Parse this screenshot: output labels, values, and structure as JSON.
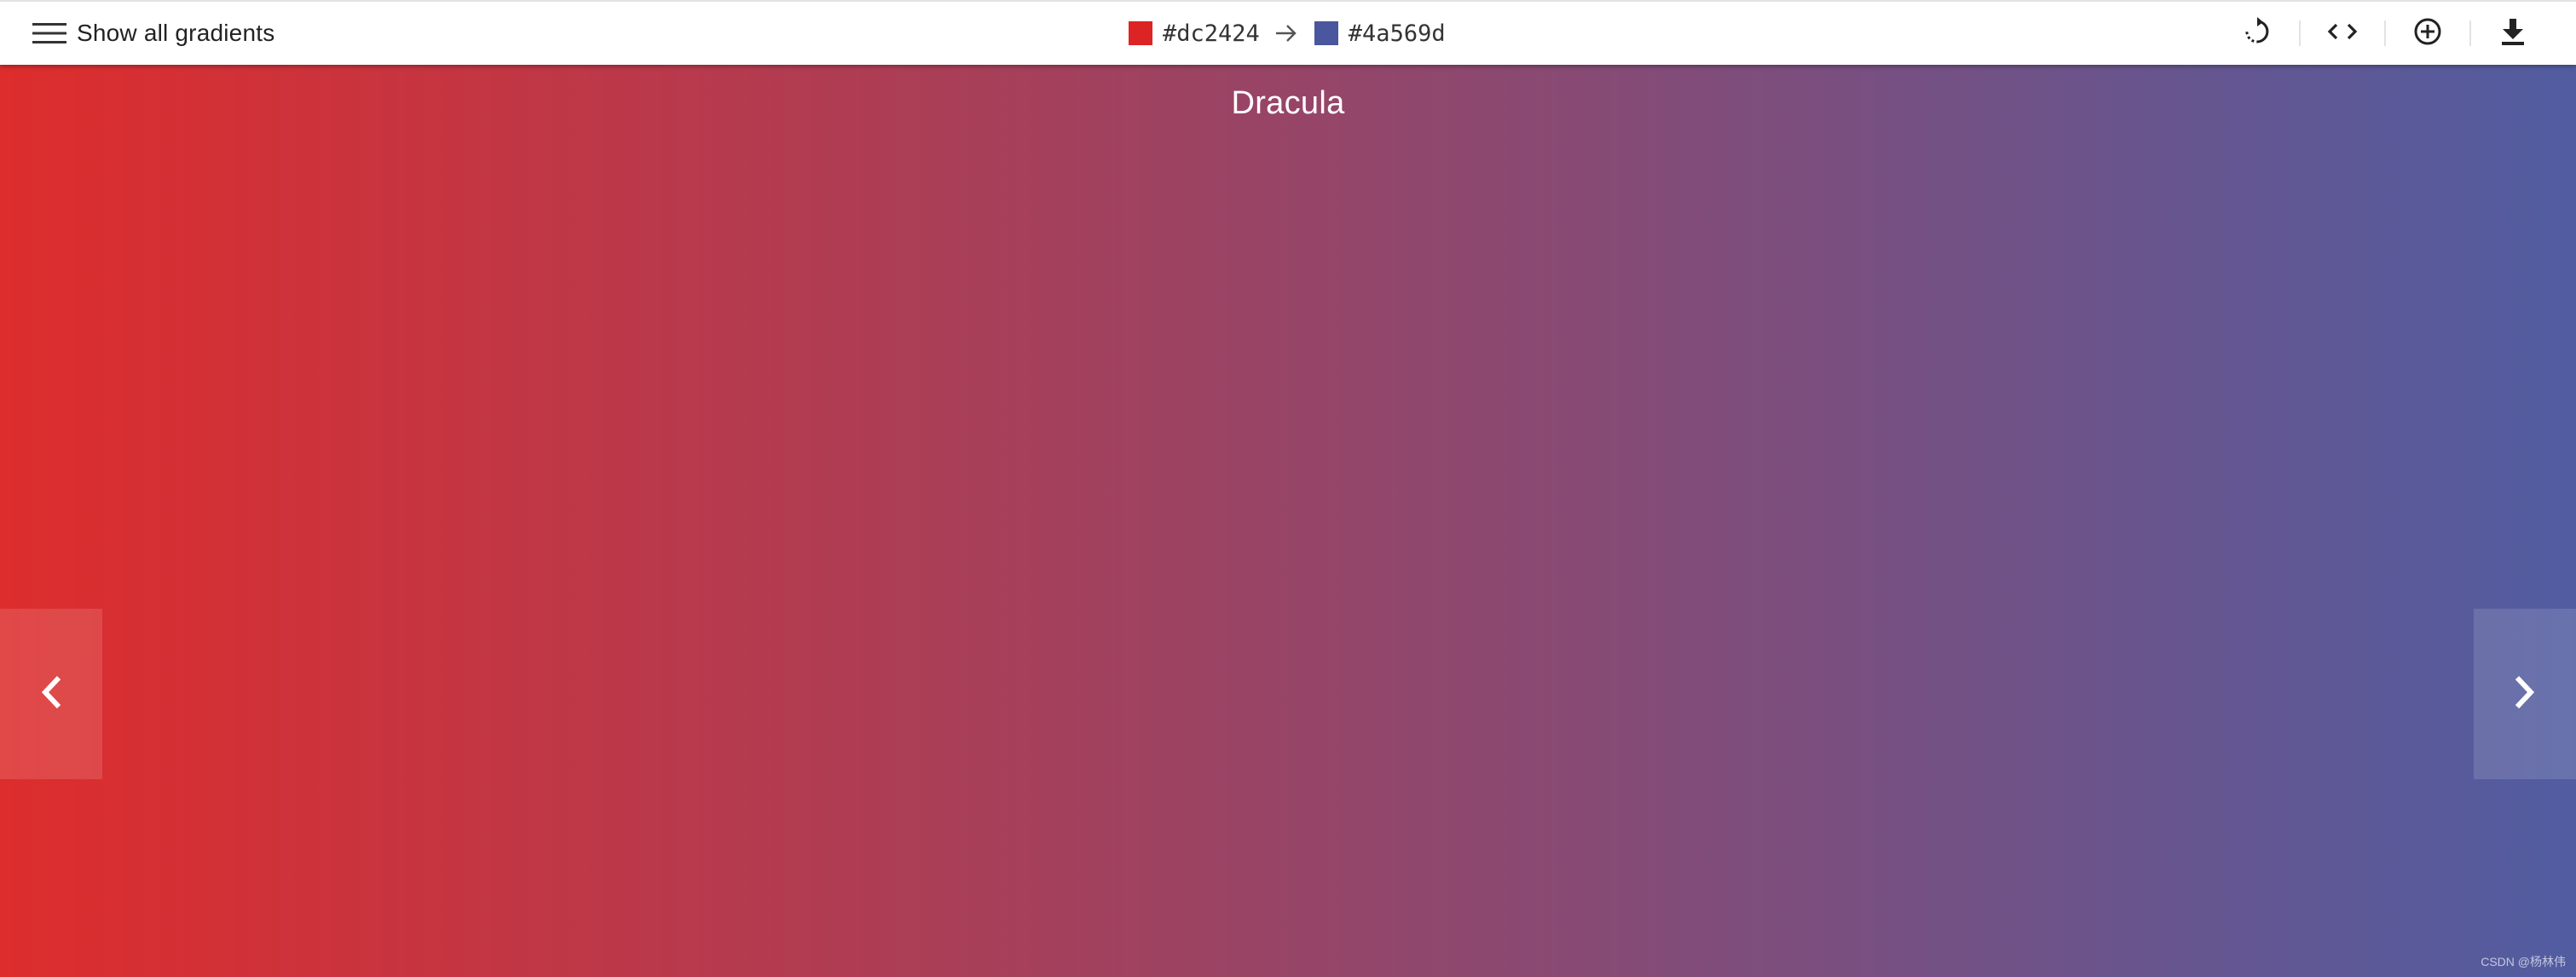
{
  "toolbar": {
    "menu_label": "Show all gradients",
    "color_from": {
      "hex": "#dc2424",
      "swatch": "#dc2424"
    },
    "color_to": {
      "hex": "#4a569d",
      "swatch": "#4a569d"
    },
    "tools": [
      {
        "icon": "rotate-icon"
      },
      {
        "icon": "code-icon"
      },
      {
        "icon": "add-circle-icon"
      },
      {
        "icon": "download-icon"
      }
    ]
  },
  "gradient": {
    "name": "Dracula",
    "direction": "to right",
    "start_color": "#dc2424",
    "end_color": "#4a569d"
  },
  "navigation": {
    "prev_icon": "chevron-left-icon",
    "next_icon": "chevron-right-icon"
  },
  "watermark": "CSDN @杨林伟"
}
